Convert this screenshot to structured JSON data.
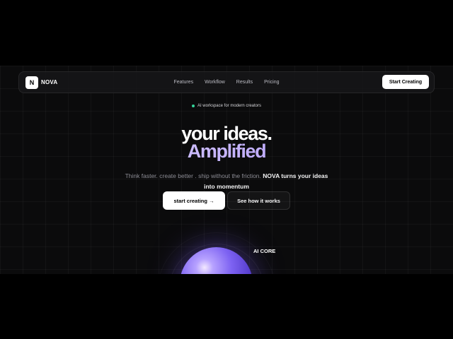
{
  "nav": {
    "logo_mark": "N",
    "brand": "NOVA",
    "links": [
      "Features",
      "Workflow",
      "Results",
      "Pricing"
    ],
    "cta": "Start Creating"
  },
  "hero": {
    "badge": "AI workspace for modern creators",
    "headline_line1": "your ideas.",
    "headline_line2": "Amplified",
    "subtitle_plain": "Think faster. create better . ship without the friction.",
    "subtitle_highlight": "NOVA turns your ideas into momentum",
    "primary_button": "start creating",
    "primary_button_arrow": "→",
    "secondary_button": "See how it works"
  },
  "orb": {
    "label": "AI CORE"
  },
  "colors": {
    "background": "#0b0b0c",
    "accent": "#a78bfa",
    "status_dot": "#34d399"
  }
}
